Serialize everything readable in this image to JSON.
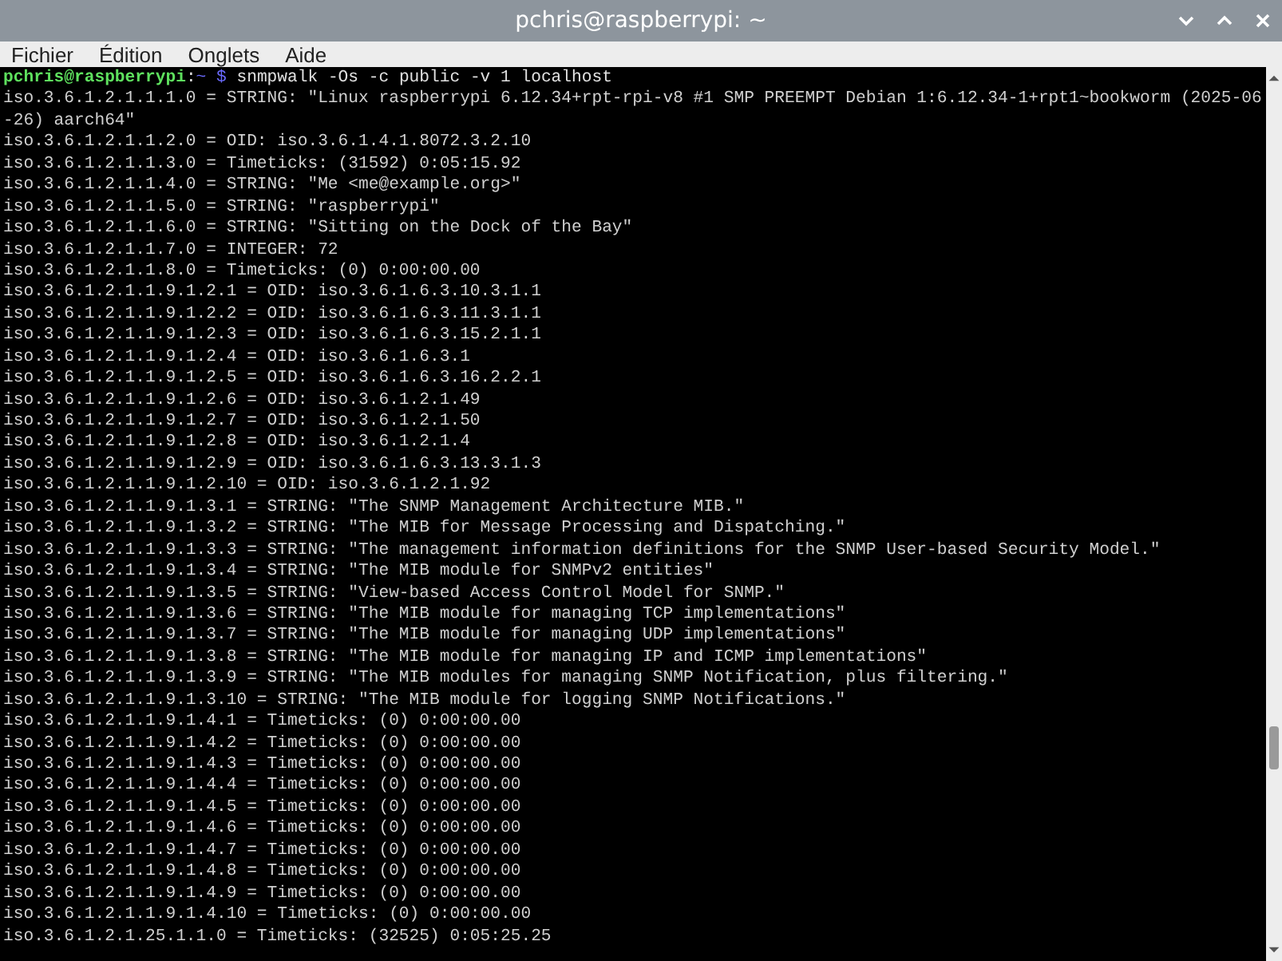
{
  "window": {
    "title": "pchris@raspberrypi: ~"
  },
  "menu": [
    "Fichier",
    "Édition",
    "Onglets",
    "Aide"
  ],
  "terminal": {
    "lines": [
      {
        "kind": "prompt",
        "user": "pchris@raspberrypi",
        "separator": ":",
        "path": "~",
        "symbol": "$",
        "command": "snmpwalk -Os -c public -v 1 localhost"
      },
      {
        "kind": "output",
        "text": "iso.3.6.1.2.1.1.1.0 = STRING: \"Linux raspberrypi 6.12.34+rpt-rpi-v8 #1 SMP PREEMPT Debian 1:6.12.34-1+rpt1~bookworm (2025-06"
      },
      {
        "kind": "output",
        "text": "-26) aarch64\""
      },
      {
        "kind": "output",
        "text": "iso.3.6.1.2.1.1.2.0 = OID: iso.3.6.1.4.1.8072.3.2.10"
      },
      {
        "kind": "output",
        "text": "iso.3.6.1.2.1.1.3.0 = Timeticks: (31592) 0:05:15.92"
      },
      {
        "kind": "output",
        "text": "iso.3.6.1.2.1.1.4.0 = STRING: \"Me <me@example.org>\""
      },
      {
        "kind": "output",
        "text": "iso.3.6.1.2.1.1.5.0 = STRING: \"raspberrypi\""
      },
      {
        "kind": "output",
        "text": "iso.3.6.1.2.1.1.6.0 = STRING: \"Sitting on the Dock of the Bay\""
      },
      {
        "kind": "output",
        "text": "iso.3.6.1.2.1.1.7.0 = INTEGER: 72"
      },
      {
        "kind": "output",
        "text": "iso.3.6.1.2.1.1.8.0 = Timeticks: (0) 0:00:00.00"
      },
      {
        "kind": "output",
        "text": "iso.3.6.1.2.1.1.9.1.2.1 = OID: iso.3.6.1.6.3.10.3.1.1"
      },
      {
        "kind": "output",
        "text": "iso.3.6.1.2.1.1.9.1.2.2 = OID: iso.3.6.1.6.3.11.3.1.1"
      },
      {
        "kind": "output",
        "text": "iso.3.6.1.2.1.1.9.1.2.3 = OID: iso.3.6.1.6.3.15.2.1.1"
      },
      {
        "kind": "output",
        "text": "iso.3.6.1.2.1.1.9.1.2.4 = OID: iso.3.6.1.6.3.1"
      },
      {
        "kind": "output",
        "text": "iso.3.6.1.2.1.1.9.1.2.5 = OID: iso.3.6.1.6.3.16.2.2.1"
      },
      {
        "kind": "output",
        "text": "iso.3.6.1.2.1.1.9.1.2.6 = OID: iso.3.6.1.2.1.49"
      },
      {
        "kind": "output",
        "text": "iso.3.6.1.2.1.1.9.1.2.7 = OID: iso.3.6.1.2.1.50"
      },
      {
        "kind": "output",
        "text": "iso.3.6.1.2.1.1.9.1.2.8 = OID: iso.3.6.1.2.1.4"
      },
      {
        "kind": "output",
        "text": "iso.3.6.1.2.1.1.9.1.2.9 = OID: iso.3.6.1.6.3.13.3.1.3"
      },
      {
        "kind": "output",
        "text": "iso.3.6.1.2.1.1.9.1.2.10 = OID: iso.3.6.1.2.1.92"
      },
      {
        "kind": "output",
        "text": "iso.3.6.1.2.1.1.9.1.3.1 = STRING: \"The SNMP Management Architecture MIB.\""
      },
      {
        "kind": "output",
        "text": "iso.3.6.1.2.1.1.9.1.3.2 = STRING: \"The MIB for Message Processing and Dispatching.\""
      },
      {
        "kind": "output",
        "text": "iso.3.6.1.2.1.1.9.1.3.3 = STRING: \"The management information definitions for the SNMP User-based Security Model.\""
      },
      {
        "kind": "output",
        "text": "iso.3.6.1.2.1.1.9.1.3.4 = STRING: \"The MIB module for SNMPv2 entities\""
      },
      {
        "kind": "output",
        "text": "iso.3.6.1.2.1.1.9.1.3.5 = STRING: \"View-based Access Control Model for SNMP.\""
      },
      {
        "kind": "output",
        "text": "iso.3.6.1.2.1.1.9.1.3.6 = STRING: \"The MIB module for managing TCP implementations\""
      },
      {
        "kind": "output",
        "text": "iso.3.6.1.2.1.1.9.1.3.7 = STRING: \"The MIB module for managing UDP implementations\""
      },
      {
        "kind": "output",
        "text": "iso.3.6.1.2.1.1.9.1.3.8 = STRING: \"The MIB module for managing IP and ICMP implementations\""
      },
      {
        "kind": "output",
        "text": "iso.3.6.1.2.1.1.9.1.3.9 = STRING: \"The MIB modules for managing SNMP Notification, plus filtering.\""
      },
      {
        "kind": "output",
        "text": "iso.3.6.1.2.1.1.9.1.3.10 = STRING: \"The MIB module for logging SNMP Notifications.\""
      },
      {
        "kind": "output",
        "text": "iso.3.6.1.2.1.1.9.1.4.1 = Timeticks: (0) 0:00:00.00"
      },
      {
        "kind": "output",
        "text": "iso.3.6.1.2.1.1.9.1.4.2 = Timeticks: (0) 0:00:00.00"
      },
      {
        "kind": "output",
        "text": "iso.3.6.1.2.1.1.9.1.4.3 = Timeticks: (0) 0:00:00.00"
      },
      {
        "kind": "output",
        "text": "iso.3.6.1.2.1.1.9.1.4.4 = Timeticks: (0) 0:00:00.00"
      },
      {
        "kind": "output",
        "text": "iso.3.6.1.2.1.1.9.1.4.5 = Timeticks: (0) 0:00:00.00"
      },
      {
        "kind": "output",
        "text": "iso.3.6.1.2.1.1.9.1.4.6 = Timeticks: (0) 0:00:00.00"
      },
      {
        "kind": "output",
        "text": "iso.3.6.1.2.1.1.9.1.4.7 = Timeticks: (0) 0:00:00.00"
      },
      {
        "kind": "output",
        "text": "iso.3.6.1.2.1.1.9.1.4.8 = Timeticks: (0) 0:00:00.00"
      },
      {
        "kind": "output",
        "text": "iso.3.6.1.2.1.1.9.1.4.9 = Timeticks: (0) 0:00:00.00"
      },
      {
        "kind": "output",
        "text": "iso.3.6.1.2.1.1.9.1.4.10 = Timeticks: (0) 0:00:00.00"
      },
      {
        "kind": "output",
        "text": "iso.3.6.1.2.1.25.1.1.0 = Timeticks: (32525) 0:05:25.25"
      }
    ]
  }
}
